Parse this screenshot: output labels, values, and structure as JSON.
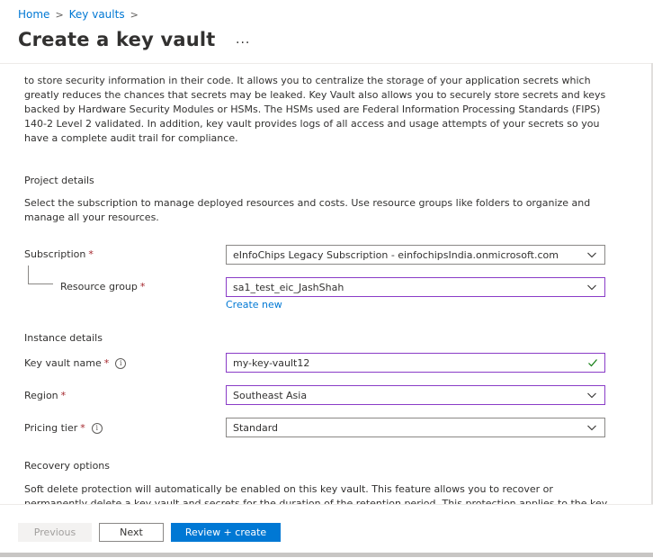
{
  "breadcrumb": {
    "items": [
      "Home",
      "Key vaults"
    ]
  },
  "page": {
    "title": "Create a key vault",
    "more": "..."
  },
  "intro": "to store security information in their code. It allows you to centralize the storage of your application secrets which greatly reduces the chances that secrets may be leaked. Key Vault also allows you to securely store secrets and keys backed by Hardware Security Modules or HSMs. The HSMs used are Federal Information Processing Standards (FIPS) 140-2 Level 2 validated. In addition, key vault provides logs of all access and usage attempts of your secrets so you have a complete audit trail for compliance.",
  "project": {
    "title": "Project details",
    "desc": "Select the subscription to manage deployed resources and costs. Use resource groups like folders to organize and manage all your resources.",
    "subscription_label": "Subscription",
    "subscription_value": "eInfoChips Legacy Subscription - einfochipsIndia.onmicrosoft.com",
    "resource_group_label": "Resource group",
    "resource_group_value": "sa1_test_eic_JashShah",
    "create_new": "Create new"
  },
  "instance": {
    "title": "Instance details",
    "name_label": "Key vault name",
    "name_value": "my-key-vault12",
    "region_label": "Region",
    "region_value": "Southeast Asia",
    "tier_label": "Pricing tier",
    "tier_value": "Standard"
  },
  "recovery": {
    "title": "Recovery options",
    "desc": "Soft delete protection will automatically be enabled on this key vault. This feature allows you to recover or permanently delete a key vault and secrets for the duration of the retention period. This protection applies to the key vault and the secrets stored"
  },
  "required_mark": "*",
  "info_glyph": "i",
  "footer": {
    "previous": "Previous",
    "next": "Next",
    "review": "Review + create"
  },
  "colors": {
    "accent": "#0078d4",
    "focus": "#8a3cc7",
    "required": "#a4262c",
    "valid": "#107c10"
  },
  "icons": {
    "chevron": "chevron-down-icon",
    "check": "checkmark-icon",
    "info": "info-icon"
  }
}
